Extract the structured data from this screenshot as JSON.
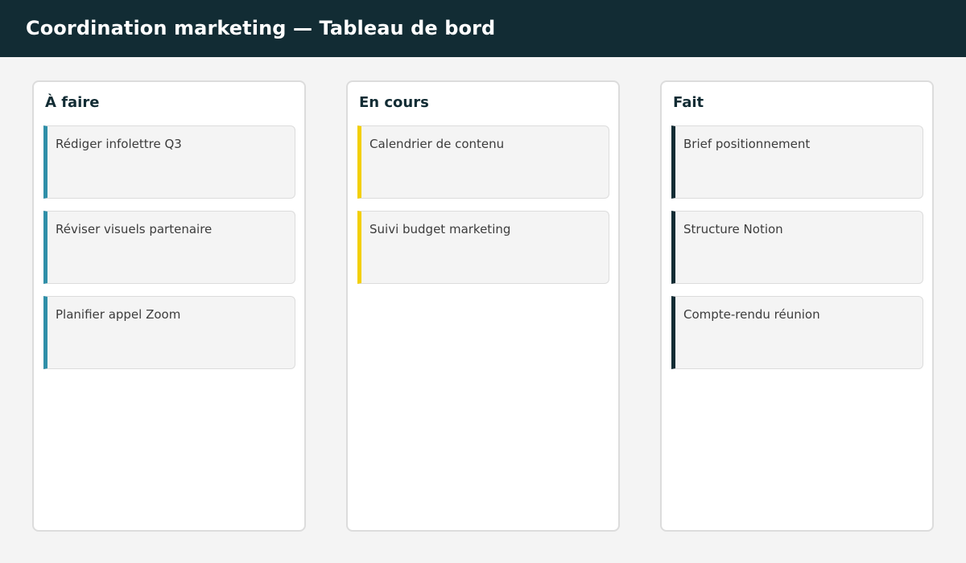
{
  "header": {
    "title": "Coordination marketing — Tableau de bord"
  },
  "board": {
    "columns": [
      {
        "title": "À faire",
        "accent": "#2f8fa8",
        "cards": [
          "Rédiger infolettre Q3",
          "Réviser visuels partenaire",
          "Planifier appel Zoom"
        ]
      },
      {
        "title": "En cours",
        "accent": "#f3cf00",
        "cards": [
          "Calendrier de contenu",
          "Suivi budget marketing"
        ]
      },
      {
        "title": "Fait",
        "accent": "#122c34",
        "cards": [
          "Brief positionnement",
          "Structure Notion",
          "Compte-rendu réunion"
        ]
      }
    ]
  },
  "colors": {
    "header_bg": "#122c34",
    "page_bg": "#f4f4f4",
    "card_bg": "#f4f4f4",
    "border": "#dcdcdc"
  }
}
